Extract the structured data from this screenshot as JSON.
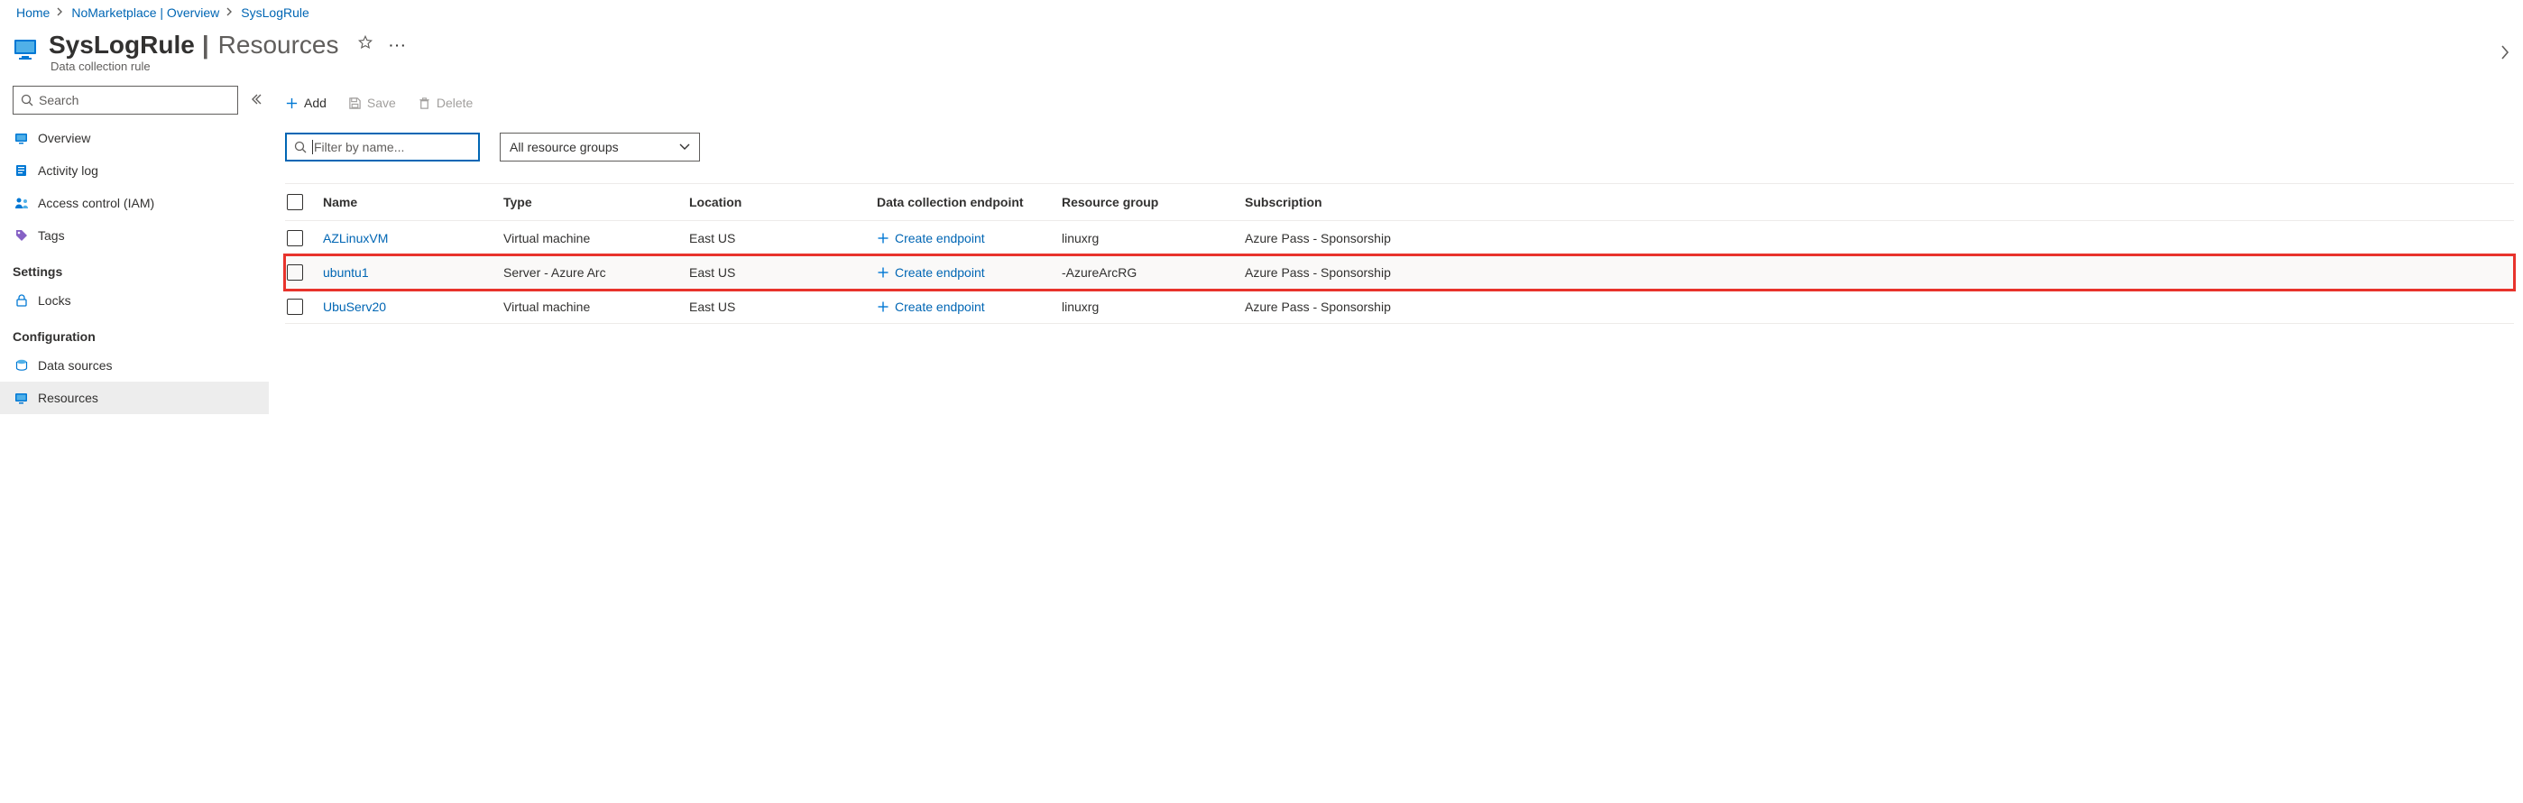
{
  "breadcrumb": {
    "items": [
      "Home",
      "NoMarketplace | Overview",
      "SysLogRule"
    ]
  },
  "header": {
    "title": "SysLogRule",
    "subtitle": "Resources",
    "kind": "Data collection rule"
  },
  "sidebar": {
    "search_placeholder": "Search",
    "items": [
      {
        "label": "Overview"
      },
      {
        "label": "Activity log"
      },
      {
        "label": "Access control (IAM)"
      },
      {
        "label": "Tags"
      }
    ],
    "settings_heading": "Settings",
    "settings_items": [
      {
        "label": "Locks"
      }
    ],
    "config_heading": "Configuration",
    "config_items": [
      {
        "label": "Data sources"
      },
      {
        "label": "Resources"
      }
    ]
  },
  "toolbar": {
    "add_label": "Add",
    "save_label": "Save",
    "delete_label": "Delete"
  },
  "filters": {
    "name_placeholder": "Filter by name...",
    "rg_selected": "All resource groups"
  },
  "grid": {
    "columns": [
      "Name",
      "Type",
      "Location",
      "Data collection endpoint",
      "Resource group",
      "Subscription"
    ],
    "endpoint_action": "Create endpoint",
    "rows": [
      {
        "name": "AZLinuxVM",
        "type": "Virtual machine",
        "location": "East US",
        "rg": "linuxrg",
        "sub": "Azure Pass - Sponsorship",
        "highlight": false
      },
      {
        "name": "ubuntu1",
        "type": "Server - Azure Arc",
        "location": "East US",
        "rg": "-AzureArcRG",
        "sub": "Azure Pass - Sponsorship",
        "highlight": true
      },
      {
        "name": "UbuServ20",
        "type": "Virtual machine",
        "location": "East US",
        "rg": "linuxrg",
        "sub": "Azure Pass - Sponsorship",
        "highlight": false
      }
    ]
  }
}
